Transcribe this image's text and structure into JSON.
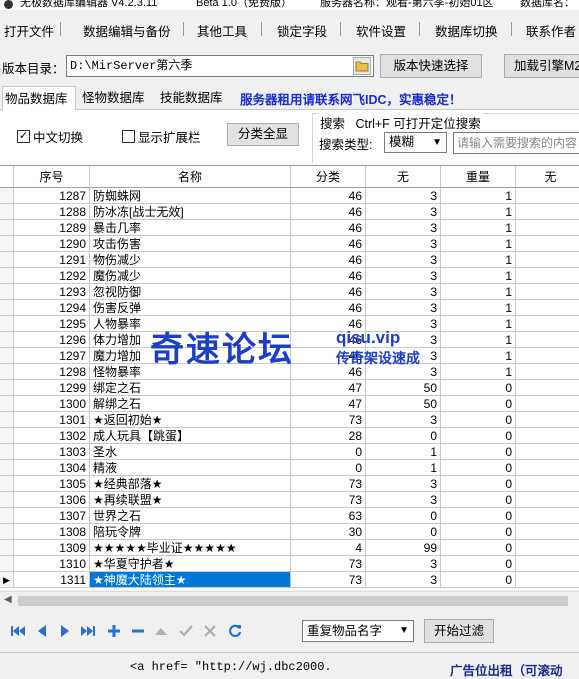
{
  "window": {
    "title": "无极数据库编辑器 V4.2.3.11",
    "beta": "Beta 1.0（免费版）",
    "server_name": "服务器名称：观看-第六季-初始01区",
    "database_name": "数据库名："
  },
  "menu": [
    "打开文件",
    "数据编辑与备份",
    "其他工具",
    "锁定字段",
    "软件设置",
    "数据库切换",
    "联系作者"
  ],
  "dir": {
    "label": "版本目录：",
    "value": "D:\\MirServer第六季",
    "quick_select": "版本快速选择",
    "load_engine": "加载引擎M2"
  },
  "tabs": [
    "物品数据库",
    "怪物数据库",
    "技能数据库"
  ],
  "banner": "服务器租用请联系网飞IDC，实惠稳定！",
  "options": {
    "chinese_switch": "中文切换",
    "chinese_checked": true,
    "show_ext": "显示扩展栏",
    "show_ext_checked": false,
    "show_all": "分类全显"
  },
  "search": {
    "title": "搜索",
    "hint": "Ctrl+F 可打开定位搜索",
    "type_label": "搜索类型:",
    "type_value": "模糊",
    "placeholder": "请输入需要搜索的内容"
  },
  "table": {
    "columns": [
      "序号",
      "名称",
      "分类",
      "无",
      "重量",
      "无"
    ],
    "rows": [
      [
        "1287",
        "防蜘蛛网",
        "46",
        "3",
        "1"
      ],
      [
        "1288",
        "防冰冻[战士无效]",
        "46",
        "3",
        "1"
      ],
      [
        "1289",
        "暴击几率",
        "46",
        "3",
        "1"
      ],
      [
        "1290",
        "攻击伤害",
        "46",
        "3",
        "1"
      ],
      [
        "1291",
        "物伤减少",
        "46",
        "3",
        "1"
      ],
      [
        "1292",
        "魔伤减少",
        "46",
        "3",
        "1"
      ],
      [
        "1293",
        "忽视防御",
        "46",
        "3",
        "1"
      ],
      [
        "1294",
        "伤害反弹",
        "46",
        "3",
        "1"
      ],
      [
        "1295",
        "人物暴率",
        "46",
        "3",
        "1"
      ],
      [
        "1296",
        "体力增加",
        "46",
        "3",
        "1"
      ],
      [
        "1297",
        "魔力增加",
        "46",
        "3",
        "1"
      ],
      [
        "1298",
        "怪物暴率",
        "46",
        "3",
        "1"
      ],
      [
        "1299",
        "绑定之石",
        "47",
        "50",
        "0"
      ],
      [
        "1300",
        "解绑之石",
        "47",
        "50",
        "0"
      ],
      [
        "1301",
        "★返回初始★",
        "73",
        "3",
        "0"
      ],
      [
        "1302",
        "成人玩具【跳蛋】",
        "28",
        "0",
        "0"
      ],
      [
        "1303",
        "圣水",
        "0",
        "1",
        "0"
      ],
      [
        "1304",
        "精液",
        "0",
        "1",
        "0"
      ],
      [
        "1305",
        "★经典部落★",
        "73",
        "3",
        "0"
      ],
      [
        "1306",
        "★再续联盟★",
        "73",
        "3",
        "0"
      ],
      [
        "1307",
        "世界之石",
        "63",
        "0",
        "0"
      ],
      [
        "1308",
        "陪玩令牌",
        "30",
        "0",
        "0"
      ],
      [
        "1309",
        "★★★★★毕业证★★★★★",
        "4",
        "99",
        "0"
      ],
      [
        "1310",
        "★华夏守护者★",
        "73",
        "3",
        "0"
      ],
      [
        "1311",
        "★神魔大陆领主★",
        "73",
        "3",
        "0"
      ]
    ],
    "selected_row": 24
  },
  "bottom": {
    "dup_select": "重复物品名字",
    "filter": "开始过滤"
  },
  "status": {
    "link": "<a href= \"http://wj.dbc2000.",
    "ad": "广告位出租（可滚动"
  },
  "watermark": {
    "main": "奇速论坛",
    "site": "qisu.vip",
    "sub": "传奇架设速成"
  },
  "colors": {
    "selection": "#0078d7",
    "banner": "#1a2bd6",
    "watermark": "#1d3fc4",
    "nav_icon": "#2a6fd6"
  }
}
